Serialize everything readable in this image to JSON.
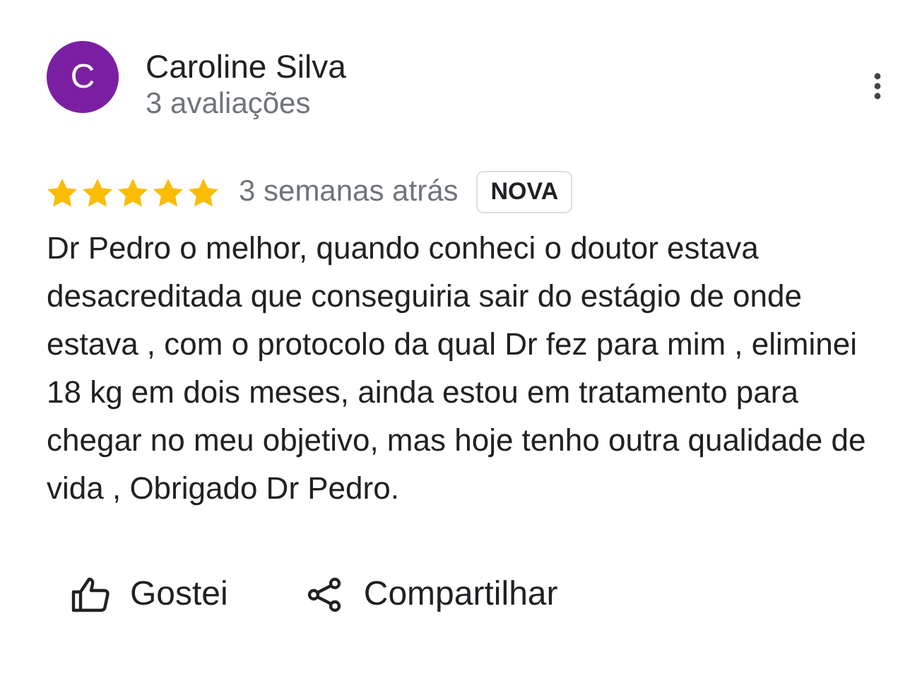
{
  "review": {
    "author": {
      "initial": "C",
      "name": "Caroline Silva",
      "subtitle": "3 avaliações",
      "color": "#7b1fa2"
    },
    "stars": 5,
    "time": "3 semanas atrás",
    "badge": "NOVA",
    "text": "Dr Pedro o melhor, quando conheci o doutor estava desacreditada que conseguiria sair do estágio de onde estava , com o protocolo da qual Dr fez para mim , eliminei 18 kg em dois meses, ainda estou em tratamento para chegar no meu objetivo, mas hoje tenho outra qualidade de vida , Obrigado Dr Pedro.",
    "actions": [
      {
        "kind": "like",
        "label": "Gostei"
      },
      {
        "kind": "share",
        "label": "Compartilhar"
      }
    ]
  }
}
